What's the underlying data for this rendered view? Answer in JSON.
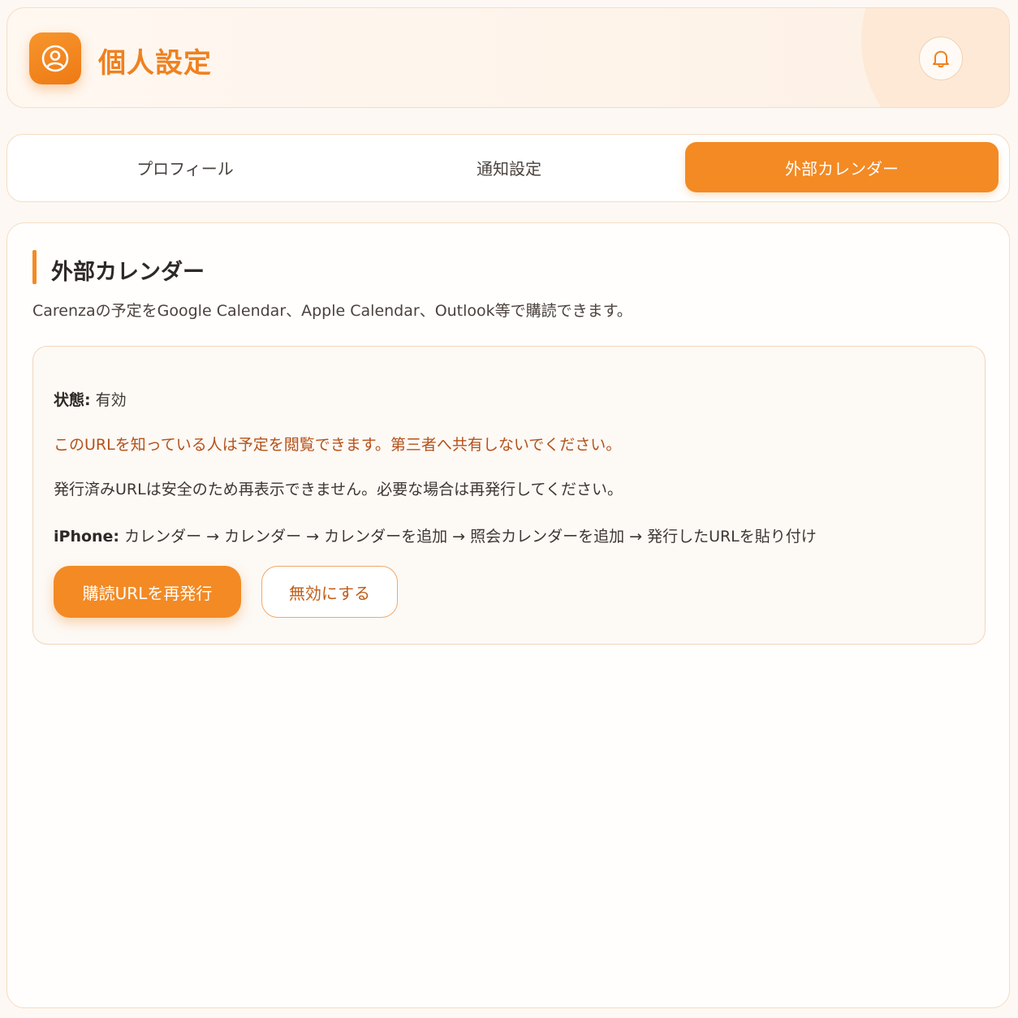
{
  "header": {
    "title": "個人設定",
    "logo_icon": "user-circle-icon",
    "bell_icon": "bell-icon"
  },
  "tabs": [
    {
      "label": "プロフィール",
      "active": false
    },
    {
      "label": "通知設定",
      "active": false
    },
    {
      "label": "外部カレンダー",
      "active": true
    }
  ],
  "section": {
    "title": "外部カレンダー",
    "description": "Carenzaの予定をGoogle Calendar、Apple Calendar、Outlook等で購読できます。"
  },
  "panel": {
    "status_label": "状態:",
    "status_value": "有効",
    "warning": "このURLを知っている人は予定を閲覧できます。第三者へ共有しないでください。",
    "note": "発行済みURLは安全のため再表示できません。必要な場合は再発行してください。",
    "iphone_label": "iPhone:",
    "iphone_steps": "カレンダー → カレンダー → カレンダーを追加 → 照会カレンダーを追加 → 発行したURLを貼り付け",
    "reissue_button": "購読URLを再発行",
    "disable_button": "無効にする"
  },
  "colors": {
    "accent": "#f38a24",
    "title": "#ef8120",
    "warning": "#b4521a"
  }
}
